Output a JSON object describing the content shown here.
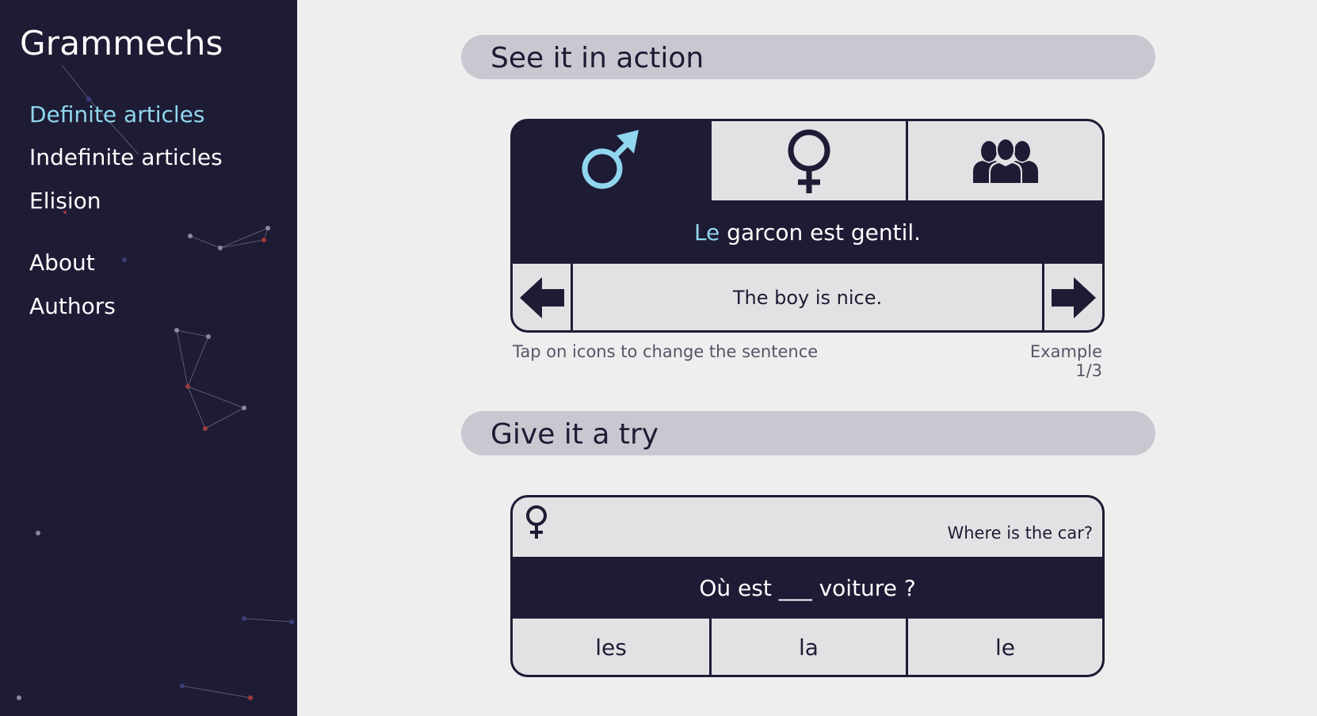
{
  "app": {
    "title": "Grammechs"
  },
  "sidebar": {
    "items": [
      {
        "label": "Definite articles"
      },
      {
        "label": "Indefinite articles"
      },
      {
        "label": "Elision"
      },
      {
        "label": "About"
      },
      {
        "label": "Authors"
      }
    ],
    "active_item": "Definite articles"
  },
  "demo": {
    "header": "See it in action",
    "tabs": [
      {
        "icon": "male-symbol-icon",
        "selected": true
      },
      {
        "icon": "female-symbol-icon",
        "selected": false
      },
      {
        "icon": "group-icon",
        "selected": false
      }
    ],
    "sentence_article": "Le",
    "sentence_rest": " garcon est gentil.",
    "translation": "The boy is nice.",
    "prev_icon": "arrow-left-icon",
    "next_icon": "arrow-right-icon",
    "hint": "Tap on icons to change the sentence",
    "counter": "Example 1/3"
  },
  "exercise": {
    "header": "Give it a try",
    "gender_icon": "female-symbol-icon",
    "translation_hint": "Where is the car?",
    "sentence": "Où est ___ voiture ?",
    "options": [
      {
        "label": "les"
      },
      {
        "label": "la"
      },
      {
        "label": "le"
      }
    ]
  },
  "colors": {
    "sidebar_bg": "#1e1b34",
    "accent": "#8fd6ee",
    "panel_bg": "#e2e2e4",
    "header_pill": "#c9c8d1",
    "page_bg": "#eeeeef"
  }
}
